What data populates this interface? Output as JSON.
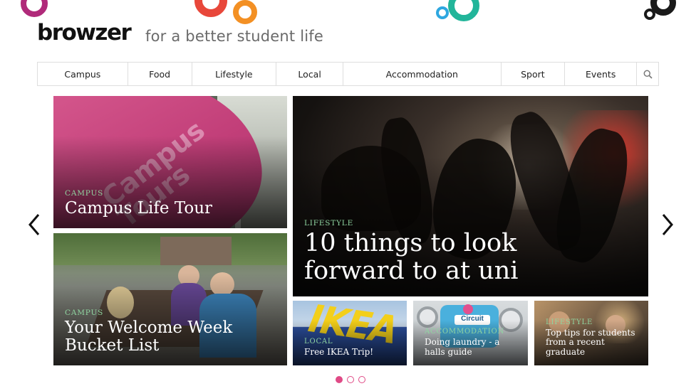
{
  "brand": {
    "logo": "browzer",
    "tagline": "for a better student life"
  },
  "nav": {
    "items": [
      "Campus",
      "Food",
      "Lifestyle",
      "Local",
      "Accommodation",
      "Sport",
      "Events"
    ],
    "search_icon": "search-icon"
  },
  "colors": {
    "accent_pink": "#e04a86",
    "ring_red": "#e8473a",
    "ring_orange": "#f39024",
    "ring_teal": "#22b59a",
    "ring_blue": "#2ea7e0",
    "ring_magenta": "#b02a7a",
    "category_green": "#8fd4a0"
  },
  "slides": [
    {
      "category": "CAMPUS",
      "title": "Campus Life Tour"
    },
    {
      "category": "LIFESTYLE",
      "title": "10 things to look forward to at uni"
    },
    {
      "category": "CAMPUS",
      "title": "Your Welcome Week Bucket List"
    },
    {
      "category": "LOCAL",
      "title": "Free IKEA Trip!"
    },
    {
      "category": "ACCOMMODATION",
      "title": "Doing laundry - a halls guide"
    },
    {
      "category": "LIFESTYLE",
      "title": "Top tips for students from a recent graduate"
    }
  ],
  "image_text": {
    "flag": "Campus Tours",
    "store_sign": "IKEA",
    "laundry_sign": "Circuit"
  },
  "carousel": {
    "prev_icon": "chevron-left-icon",
    "next_icon": "chevron-right-icon",
    "page_count": 3,
    "active_page": 1
  }
}
